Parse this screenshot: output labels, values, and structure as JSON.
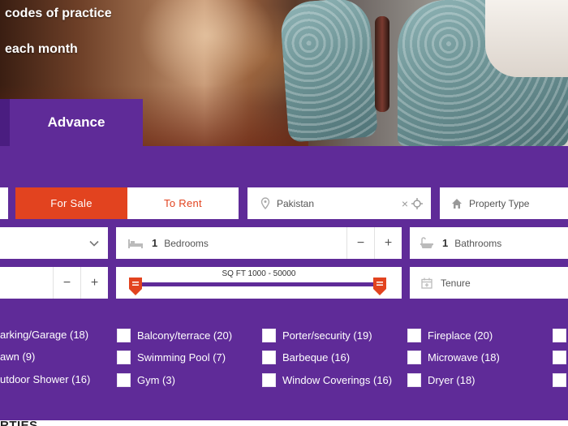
{
  "hero": {
    "line1": "codes of practice",
    "line2": "each month"
  },
  "tabs": {
    "advance": "Advance"
  },
  "search": {
    "for_sale": "For Sale",
    "to_rent": "To Rent",
    "location": "Pakistan",
    "property_type": "Property Type",
    "bedrooms_value": "1",
    "bedrooms_label": "Bedrooms",
    "bathrooms_value": "1",
    "bathrooms_label": "Bathrooms",
    "sqft_label": "SQ FT 1000  -  50000",
    "tenure": "Tenure",
    "minus": "−",
    "plus": "+"
  },
  "amenities": [
    "arking/Garage (18)",
    "Balcony/terrace (20)",
    "Porter/security (19)",
    "Fireplace (20)",
    "awn (9)",
    "Swimming Pool (7)",
    "Barbeque (16)",
    "Microwave (18)",
    "utdoor Shower (16)",
    "Gym (3)",
    "Window Coverings (16)",
    "Dryer (18)"
  ],
  "footer": {
    "heading_fragment": "RTIES"
  },
  "colors": {
    "panel_purple": "#5f2b98",
    "accent_orange": "#e2431f"
  }
}
